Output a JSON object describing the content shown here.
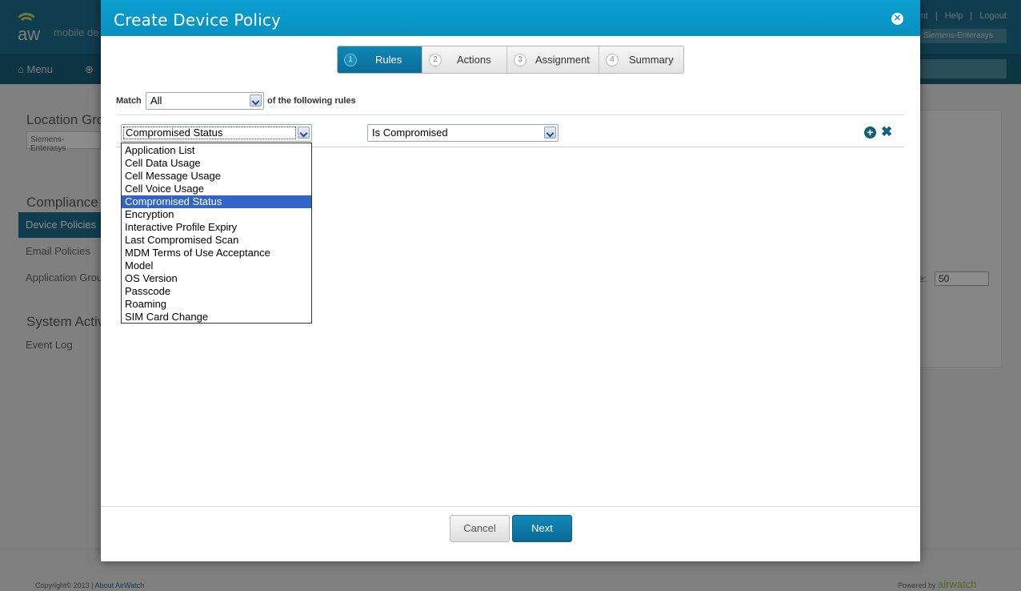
{
  "background": {
    "brand": "mobile de",
    "top_links": [
      "nt",
      "|",
      "Help",
      "|",
      "Logout"
    ],
    "org_select": "Siemens-Enterasys",
    "nav_menu": "Menu",
    "sidebar": {
      "location_heading": "Location Grou",
      "location_select": "Siemens-Enterasys",
      "compliance_heading": "Compliance",
      "items": [
        "Device Policies",
        "Email Policies",
        "Application Grou"
      ],
      "system_heading": "System Activi",
      "event_log": "Event Log"
    },
    "page_size_label": "ze:",
    "page_size": "50",
    "copyright": "Copyright© 2013 |",
    "about_link": "About AirWatch",
    "powered_by": "Powered by",
    "powered_brand": "airwatch"
  },
  "modal": {
    "title": "Create Device Policy",
    "steps": [
      {
        "num": "1",
        "label": "Rules"
      },
      {
        "num": "2",
        "label": "Actions"
      },
      {
        "num": "3",
        "label": "Assignment"
      },
      {
        "num": "4",
        "label": "Summary"
      }
    ],
    "active_step": "Rules",
    "match_label": "Match",
    "match_value": "All",
    "following_label": "of the following rules",
    "rule": {
      "attribute": "Compromised Status",
      "condition": "Is Compromised"
    },
    "attribute_options": [
      "Application List",
      "Cell Data Usage",
      "Cell Message Usage",
      "Cell Voice Usage",
      "Compromised Status",
      "Encryption",
      "Interactive Profile Expiry",
      "Last Compromised Scan",
      "MDM Terms of Use Acceptance",
      "Model",
      "OS Version",
      "Passcode",
      "Roaming",
      "SIM Card Change"
    ],
    "selected_option_index": 4,
    "cancel_label": "Cancel",
    "next_label": "Next"
  }
}
